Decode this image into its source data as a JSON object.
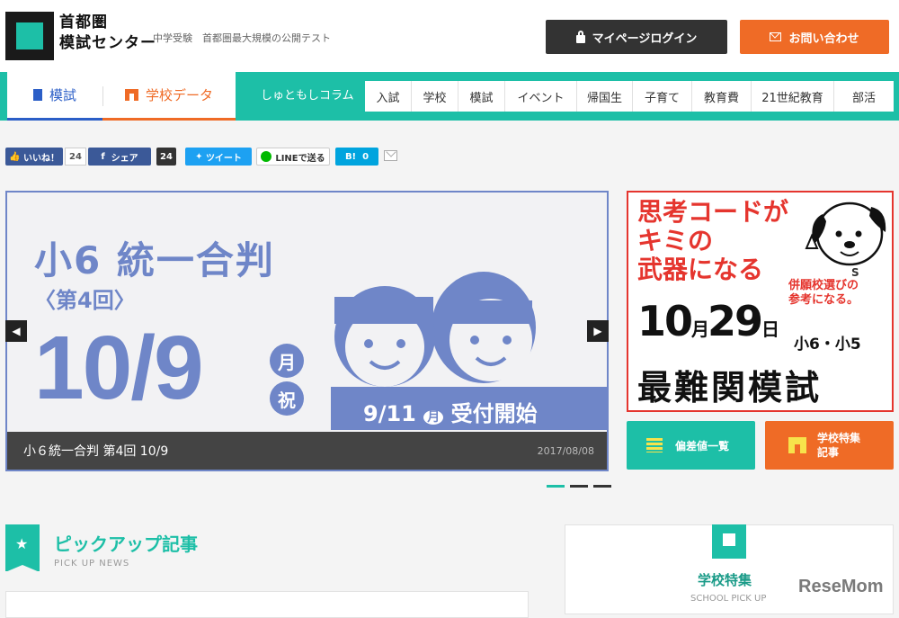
{
  "header": {
    "logo_line1": "首都圏",
    "logo_line2": "模試センター",
    "tagline": "中学受験　首都圏最大規模の公開テスト",
    "login_label": "マイページログイン",
    "contact_label": "お問い合わせ"
  },
  "nav": {
    "tabs": [
      {
        "label": "模試"
      },
      {
        "label": "学校データ"
      }
    ],
    "column_label": "しゅともしコラム",
    "categories": [
      "入試",
      "学校",
      "模試",
      "イベント",
      "帰国生",
      "子育て",
      "教育費",
      "21世紀教育",
      "部活"
    ]
  },
  "share": {
    "like_label": "いいね！",
    "like_count": "24",
    "fb_label": "シェア",
    "fb_count": "24",
    "tweet_label": "ツイート",
    "line_label": "LINEで送る",
    "hatena_label": "B!",
    "hatena_count": "0"
  },
  "slider": {
    "title": "小6 統一合判",
    "subtitle": "〈第4回〉",
    "date": "10/9",
    "month_char": "月",
    "holiday_char": "祝",
    "accept": "9/11",
    "accept_day": "月",
    "accept_text": "受付開始",
    "caption": "小６統一合判 第4回 10/9",
    "caption_date": "2017/08/08",
    "total_slides": 3,
    "active_slide": 1
  },
  "ad": {
    "line1": "思考コードが",
    "line2": "キミの",
    "line3": "武器になる",
    "sub1": "併願校選びの",
    "sub2": "参考になる。",
    "date_m": "10",
    "date_m_unit": "月",
    "date_d": "29",
    "date_d_unit": "日",
    "grades": "小6・小5",
    "main": "最難関模試",
    "dog_badge": "S"
  },
  "side": {
    "deviation_label": "偏差値一覧",
    "school_feature_line1": "学校特集",
    "school_feature_line2": "記事"
  },
  "pickup": {
    "title": "ピックアップ記事",
    "subtitle": "PICK UP NEWS"
  },
  "school_pick": {
    "title": "学校特集",
    "subtitle": "SCHOOL PICK UP"
  },
  "watermark": "ReseMom",
  "colors": {
    "teal": "#1dbfa7",
    "orange": "#ef6b26",
    "slide_blue": "#6f86c8",
    "ad_red": "#e5352e"
  }
}
